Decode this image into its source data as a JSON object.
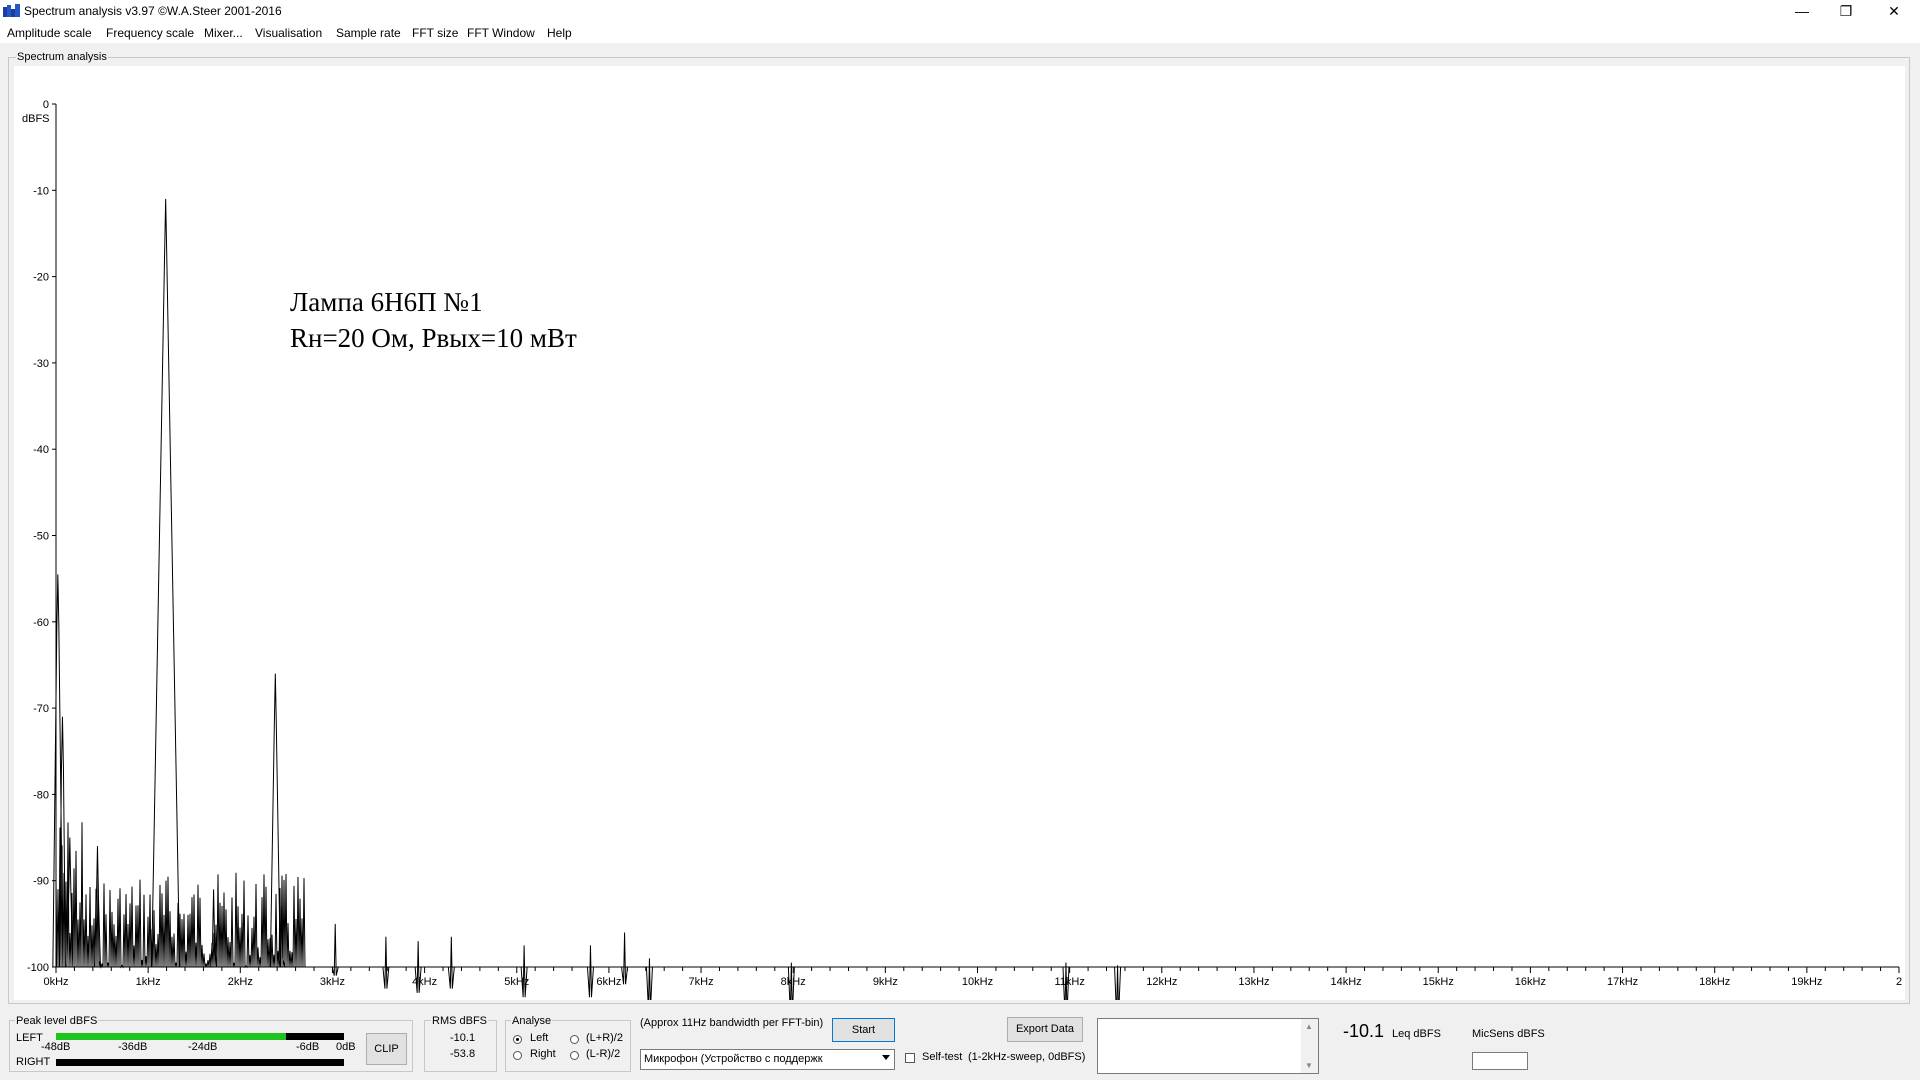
{
  "window": {
    "title": "Spectrum analysis v3.97  ©W.A.Steer 2001-2016",
    "minimize_glyph": "—",
    "restore_glyph": "❐",
    "close_glyph": "✕"
  },
  "menu": [
    {
      "label": "Amplitude scale"
    },
    {
      "label": "Frequency scale"
    },
    {
      "label": "Mixer..."
    },
    {
      "label": "Visualisation"
    },
    {
      "label": "Sample rate"
    },
    {
      "label": "FFT size"
    },
    {
      "label": "FFT Window"
    },
    {
      "label": "Help"
    }
  ],
  "chart_group_label": "Spectrum analysis",
  "chart_data": {
    "type": "line",
    "ylabel": "dBFS",
    "ylim": [
      -100,
      0
    ],
    "xlim": [
      0,
      20
    ],
    "y_ticks": [
      "0",
      "-10",
      "-20",
      "-30",
      "-40",
      "-50",
      "-60",
      "-70",
      "-80",
      "-90",
      "-100"
    ],
    "x_ticks": [
      "0kHz",
      "1kHz",
      "2kHz",
      "3kHz",
      "4kHz",
      "5kHz",
      "6kHz",
      "7kHz",
      "8kHz",
      "9kHz",
      "10kHz",
      "11kHz",
      "12kHz",
      "13kHz",
      "14kHz",
      "15kHz",
      "16kHz",
      "17kHz",
      "18kHz",
      "19kHz",
      "2"
    ],
    "annotation": [
      "Лампа 6Н6П №1",
      "Rн=20 Ом, Pвых=10 мВт"
    ],
    "peaks": [
      {
        "x": 0.02,
        "y": -54.5
      },
      {
        "x": 0.07,
        "y": -71
      },
      {
        "x": 0.15,
        "y": -85
      },
      {
        "x": 0.45,
        "y": -86
      },
      {
        "x": 1.19,
        "y": -11
      },
      {
        "x": 1.71,
        "y": -91
      },
      {
        "x": 2.38,
        "y": -66
      },
      {
        "x": 2.45,
        "y": -93
      },
      {
        "x": 3.03,
        "y": -95
      },
      {
        "x": 3.58,
        "y": -96.5
      },
      {
        "x": 3.93,
        "y": -97
      },
      {
        "x": 4.29,
        "y": -96.5
      },
      {
        "x": 5.08,
        "y": -97.5
      },
      {
        "x": 5.8,
        "y": -97.5
      },
      {
        "x": 6.17,
        "y": -96
      },
      {
        "x": 6.44,
        "y": -99
      },
      {
        "x": 7.98,
        "y": -99.5
      },
      {
        "x": 10.96,
        "y": -99.5
      },
      {
        "x": 11.52,
        "y": -99.8
      }
    ]
  },
  "peak_meter": {
    "label": "Peak level dBFS",
    "left_label": "LEFT",
    "right_label": "RIGHT",
    "scale": [
      "-48dB",
      "-36dB",
      "-24dB",
      "-6dB",
      "0dB"
    ],
    "left_level_fraction": 0.8,
    "clip_label": "CLIP",
    "left_bar_color": "#1ec41e",
    "meter_bg_color": "#000000"
  },
  "rms": {
    "label": "RMS dBFS",
    "left": "-10.1",
    "right": "-53.8"
  },
  "analyse": {
    "label": "Analyse",
    "options": [
      {
        "label": "Left",
        "selected": true
      },
      {
        "label": "Right",
        "selected": false
      },
      {
        "label": "(L+R)/2",
        "selected": false
      },
      {
        "label": "(L-R)/2",
        "selected": false
      }
    ]
  },
  "bandwidth_text": "(Approx 11Hz bandwidth per FFT-bin)",
  "start_button": "Start",
  "device_select": "Микрофон (Устройство с поддержк",
  "self_test": {
    "label": "Self-test",
    "note": "(1-2kHz-sweep, 0dBFS)",
    "checked": false
  },
  "export_button": "Export Data",
  "leq": {
    "value": "-10.1",
    "label": "Leq dBFS"
  },
  "micsens_label": "MicSens dBFS",
  "micsens_value": ""
}
